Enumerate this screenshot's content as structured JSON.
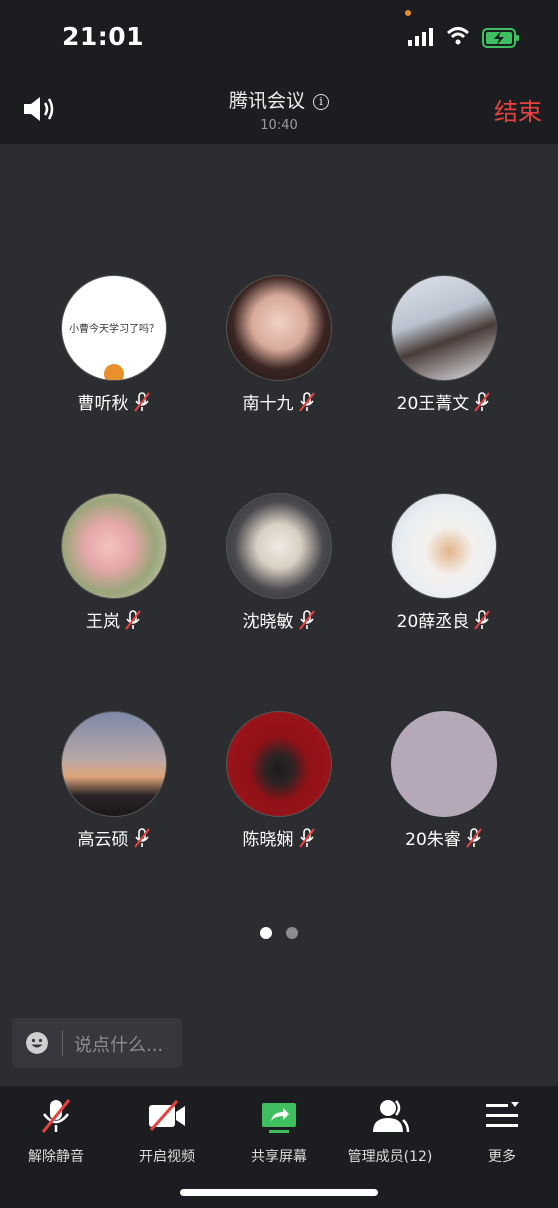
{
  "status_bar": {
    "time": "21:01"
  },
  "header": {
    "title": "腾讯会议",
    "duration": "10:40",
    "end_label": "结束"
  },
  "avatar_text": "小曹今天学习了吗？",
  "members": [
    {
      "name": "曹听秋",
      "muted": true
    },
    {
      "name": "南十九",
      "muted": true
    },
    {
      "name": "20王菁文",
      "muted": true
    },
    {
      "name": "王岚",
      "muted": true
    },
    {
      "name": "沈晓敏",
      "muted": true
    },
    {
      "name": "20薛丞良",
      "muted": true
    },
    {
      "name": "高云硕",
      "muted": true
    },
    {
      "name": "陈晓娴",
      "muted": true
    },
    {
      "name": "20朱睿",
      "muted": true
    }
  ],
  "pager": {
    "pages": 2,
    "current": 1
  },
  "chat": {
    "placeholder": "说点什么..."
  },
  "toolbar": {
    "unmute": "解除静音",
    "start_video": "开启视频",
    "share_screen": "共享屏幕",
    "manage_members": "管理成员(12)",
    "more": "更多"
  },
  "colors": {
    "end": "#e64340",
    "share": "#3fbf5f",
    "accent": "#e8902c"
  }
}
